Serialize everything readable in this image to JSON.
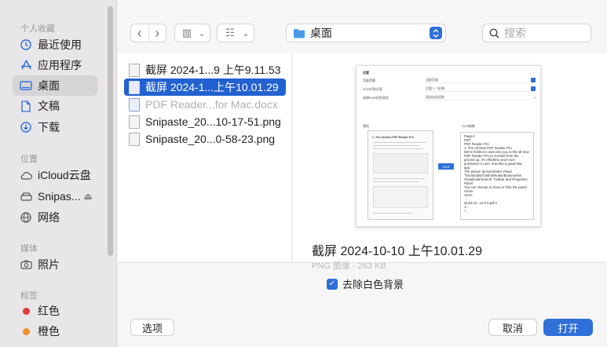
{
  "sidebar": {
    "favorites_title": "个人收藏",
    "favorites": [
      {
        "label": "最近使用",
        "icon": "clock-icon"
      },
      {
        "label": "应用程序",
        "icon": "applications-icon"
      },
      {
        "label": "桌面",
        "icon": "desktop-icon",
        "selected": true
      },
      {
        "label": "文稿",
        "icon": "document-icon"
      },
      {
        "label": "下载",
        "icon": "download-icon"
      }
    ],
    "locations_title": "位置",
    "locations": [
      {
        "label": "iCloud云盘",
        "icon": "cloud-icon"
      },
      {
        "label": "Snipas...",
        "icon": "drive-icon",
        "eject": "⏏"
      },
      {
        "label": "网络",
        "icon": "network-icon"
      }
    ],
    "media_title": "媒体",
    "media": [
      {
        "label": "照片",
        "icon": "camera-icon"
      }
    ],
    "tags_title": "标签",
    "tags": [
      {
        "label": "红色",
        "color": "#e33d3d"
      },
      {
        "label": "橙色",
        "color": "#f0922f"
      }
    ]
  },
  "toolbar": {
    "back": "‹",
    "forward": "›",
    "view_icon": "▥",
    "group_icon": "☷",
    "chevron": "⌄",
    "location": "桌面",
    "location_arrow": "⌃",
    "search_placeholder": "搜索"
  },
  "files": [
    {
      "name": "截屏 2024-1...9 上午9.11.53",
      "type": "image"
    },
    {
      "name": "截屏 2024-1...上午10.01.29",
      "type": "image",
      "selected": true
    },
    {
      "name": "PDF Reader...for Mac.docx",
      "type": "doc",
      "dim": true
    },
    {
      "name": "Snipaste_20...10-17-51.png",
      "type": "image"
    },
    {
      "name": "Snipaste_20...0-58-23.png",
      "type": "image"
    }
  ],
  "preview": {
    "title": "截屏 2024-10-10 上午10.01.29",
    "subtitle": "PNG 图像 - 263 KB",
    "thumb": {
      "settings_label": "设置",
      "rows": [
        {
          "label": "页面范围",
          "value": "当前页面"
        },
        {
          "label": "OCR识别方案",
          "value": "方案 1（在线）"
        },
        {
          "label": "选择OCR识别语言:",
          "value": "语言自动识别"
        }
      ],
      "help": "?",
      "preview_label": "预览",
      "result_label": "OCR结果",
      "doc_heading": "1. The All-New PDF Reader Pro",
      "ocr_button": "OCR",
      "ocr_text": "Page 6\nPDF\nPDF Reader Pro\n1. The All-New PDF Reader Pro\nWe're thrilled to welcome you to the all-new PDF Reader Pro re-created from the\nground up. It's effortless and more productive to use. Just like a great Mac app.\nThe picture demonstrates Panel Thumbnails/Outline/Notes/Bookmarks/\nSnapshots/Search, Toolbar and Properties Panel.\nYou can choose to show or hide the panel.\nHome\n112%\n→\nQuick St...v4.0.0.pdf.x\n1 ↓\n+"
    }
  },
  "options": {
    "remove_white_bg": "去除白色背景",
    "checkmark": "✓"
  },
  "buttons": {
    "options": "选项",
    "cancel": "取消",
    "open": "打开"
  },
  "colors": {
    "accent": "#2f6fd8",
    "selection": "#2261cf"
  }
}
